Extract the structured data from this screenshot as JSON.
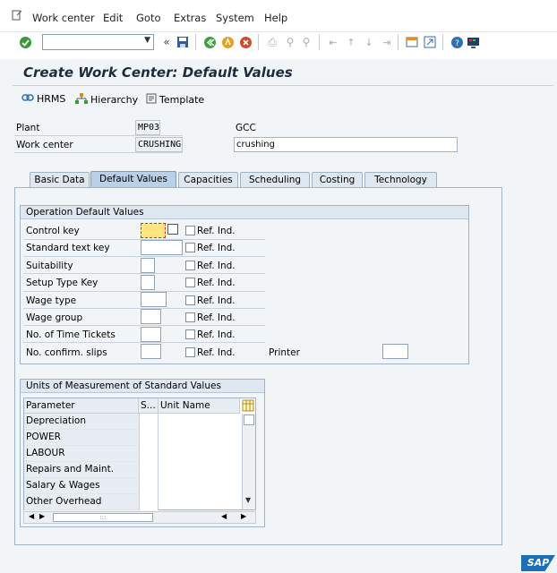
{
  "menubar": {
    "items": [
      "Work center",
      "Edit",
      "Goto",
      "Extras",
      "System",
      "Help"
    ]
  },
  "toolbar": {
    "command_value": "",
    "icons": [
      "enter-icon",
      "command-dropdown-icon",
      "history-back-icon",
      "save-icon",
      "back-icon",
      "exit-icon",
      "cancel-icon",
      "print-icon",
      "find-icon",
      "find-next-icon",
      "first-page-icon",
      "previous-page-icon",
      "next-page-icon",
      "last-page-icon",
      "create-session-icon",
      "shortcut-icon",
      "help-icon",
      "customize-icon"
    ]
  },
  "header": {
    "title": "Create Work Center: Default Values"
  },
  "app_toolbar": {
    "hrms": "HRMS",
    "hierarchy": "Hierarchy",
    "template": "Template"
  },
  "identity": {
    "plant_label": "Plant",
    "plant_value": "MP03",
    "plant_desc": "GCC",
    "workcenter_label": "Work center",
    "workcenter_value": "CRUSHING",
    "workcenter_desc": "crushing"
  },
  "tabs": [
    "Basic Data",
    "Default Values",
    "Capacities",
    "Scheduling",
    "Costing",
    "Technology"
  ],
  "active_tab": "Default Values",
  "operation_defaults": {
    "title": "Operation Default Values",
    "ref_label": "Ref. Ind.",
    "rows": [
      {
        "label": "Control key",
        "value": ""
      },
      {
        "label": "Standard text key",
        "value": ""
      },
      {
        "label": "Suitability",
        "value": ""
      },
      {
        "label": "Setup Type Key",
        "value": ""
      },
      {
        "label": "Wage type",
        "value": ""
      },
      {
        "label": "Wage group",
        "value": ""
      },
      {
        "label": "No. of Time Tickets",
        "value": ""
      },
      {
        "label": "No. confirm. slips",
        "value": ""
      }
    ],
    "printer_label": "Printer",
    "printer_value": ""
  },
  "units": {
    "title": "Units of Measurement of Standard Values",
    "columns": [
      "Parameter",
      "S...",
      "Unit Name"
    ],
    "rows": [
      "Depreciation",
      "POWER",
      "LABOUR",
      "Repairs and Maint.",
      "Salary & Wages",
      "Other Overhead"
    ]
  },
  "footer": {
    "logo": "SAP"
  },
  "colors": {
    "accent": "#1a6fb6",
    "active_field": "#ffe680",
    "tab_active": "#b9d0e8"
  }
}
